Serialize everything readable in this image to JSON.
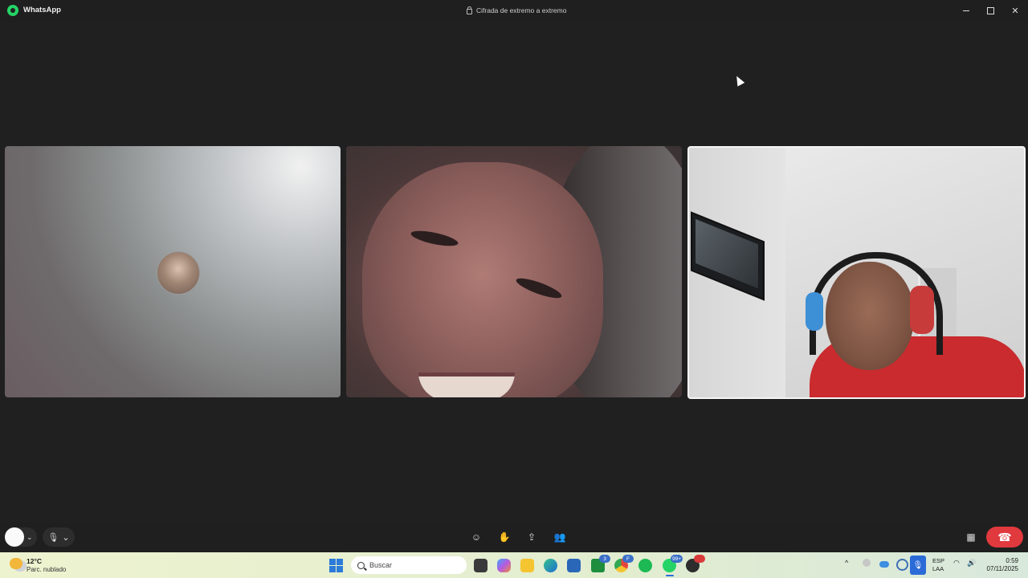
{
  "app": {
    "title": "WhatsApp",
    "encryption_label": "Cifrada de extremo a extremo"
  },
  "window_controls": {
    "minimize": "—",
    "maximize": "❐",
    "close": "✕"
  },
  "participants": [
    {
      "type": "avatar-only"
    },
    {
      "type": "video"
    },
    {
      "type": "video",
      "self": true,
      "highlighted": true
    }
  ],
  "controls": {
    "camera_chevron": "⌄",
    "mic_icon": "🎙",
    "mic_chevron": "⌄",
    "emoji_icon": "☺",
    "hand_icon": "✋",
    "share_icon": "⇪",
    "people_icon": "👥",
    "layout_icon": "▦",
    "end_call_icon": "☎"
  },
  "taskbar": {
    "weather": {
      "temp": "12°C",
      "desc": "Parc. nublado"
    },
    "search_placeholder": "Buscar",
    "badges": {
      "xbox": "3",
      "chrome": "F",
      "whatsapp": "99+"
    },
    "tray": {
      "chevron": "^",
      "lang_top": "ESP",
      "lang_bottom": "LAA",
      "wifi": "◠",
      "volume": "🔊"
    },
    "clock": {
      "time": "0:59",
      "date": "07/11/2025"
    }
  },
  "colors": {
    "end_call": "#e0393e",
    "accent": "#2b6bd8",
    "whatsapp": "#25d366"
  }
}
